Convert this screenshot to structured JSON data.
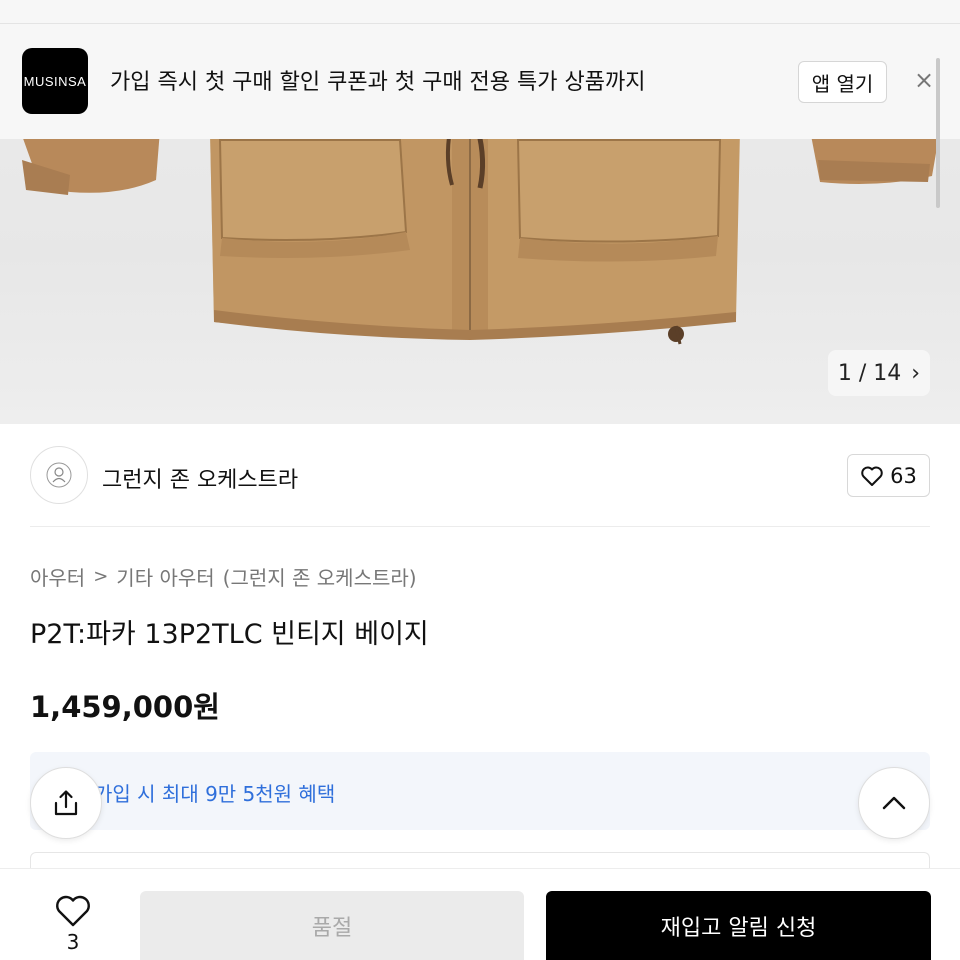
{
  "banner": {
    "logo_text": "MUSINSA",
    "message": "가입 즉시 첫 구매 할인 쿠폰과 첫 구매 전용 특가 상품까지",
    "open_app_label": "앱 열기",
    "close_symbol": "×"
  },
  "gallery": {
    "counter": "1 / 14",
    "next_symbol": "›"
  },
  "brand": {
    "name": "그런지 존 오케스트라",
    "like_count": "63"
  },
  "breadcrumb": {
    "category": "아우터",
    "separator": ">",
    "subcategory": "기타 아우터",
    "brand_ref": "(그런지 존 오케스트라)"
  },
  "product": {
    "title": "P2T:파카 13P2TLC 빈티지 베이지",
    "price": "1,459,000원"
  },
  "benefit": {
    "text": "가입 시 최대 9만 5천원 혜택"
  },
  "bottom_bar": {
    "wish_count": "3",
    "soldout_label": "품절",
    "restock_label": "재입고 알림 신청"
  },
  "icons": {
    "share": "share-icon",
    "scroll_top": "chevron-up-icon",
    "heart": "heart-icon",
    "close": "close-icon"
  },
  "colors": {
    "benefit_text": "#2f6fdb",
    "primary_button": "#000000",
    "disabled_button": "#ebebeb",
    "jacket": "#c49a66"
  }
}
